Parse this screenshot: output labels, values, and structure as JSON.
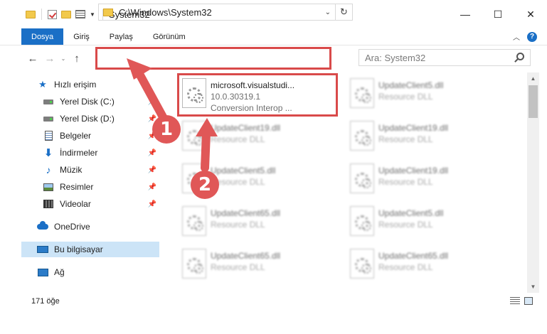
{
  "window": {
    "title": "System32",
    "minimize": "—",
    "maximize": "☐",
    "close": "✕"
  },
  "ribbon": {
    "tabs": [
      {
        "label": "Dosya",
        "active": true
      },
      {
        "label": "Giriş"
      },
      {
        "label": "Paylaş"
      },
      {
        "label": "Görünüm"
      }
    ],
    "help": "?"
  },
  "nav": {
    "back": "←",
    "forward": "→",
    "recent": "⌄",
    "up": "↑",
    "address": "C:\\Windows\\System32",
    "dropdown": "⌄",
    "refresh": "↻",
    "search_placeholder": "Ara: System32"
  },
  "sidebar": {
    "items": [
      {
        "label": "Hızlı erişim",
        "icon": "star-icon"
      },
      {
        "label": "Yerel Disk (C:)",
        "icon": "disk-icon",
        "pinned": true
      },
      {
        "label": "Yerel Disk (D:)",
        "icon": "disk-icon",
        "pinned": true
      },
      {
        "label": "Belgeler",
        "icon": "document-icon",
        "pinned": true
      },
      {
        "label": "İndirmeler",
        "icon": "download-icon",
        "pinned": true
      },
      {
        "label": "Müzik",
        "icon": "music-icon",
        "pinned": true
      },
      {
        "label": "Resimler",
        "icon": "picture-icon",
        "pinned": true
      },
      {
        "label": "Videolar",
        "icon": "video-icon",
        "pinned": true
      },
      {
        "label": "OneDrive",
        "icon": "cloud-icon"
      },
      {
        "label": "Bu bilgisayar",
        "icon": "computer-icon",
        "selected": true
      },
      {
        "label": "Ağ",
        "icon": "network-icon"
      }
    ],
    "pin_glyph": "📌"
  },
  "files": [
    {
      "name": "microsoft.visualstudi...",
      "line2": "10.0.30319.1",
      "line3": "Conversion Interop ...",
      "highlighted": true
    },
    {
      "name": "UpdateClient5.dll",
      "line2": "Resource DLL"
    },
    {
      "name": "UpdateClient19.dll",
      "line2": "Resource DLL"
    },
    {
      "name": "UpdateClient19.dll",
      "line2": "Resource DLL"
    },
    {
      "name": "UpdateClient5.dll",
      "line2": "Resource DLL"
    },
    {
      "name": "UpdateClient19.dll",
      "line2": "Resource DLL"
    },
    {
      "name": "UpdateClient65.dll",
      "line2": "Resource DLL"
    },
    {
      "name": "UpdateClient5.dll",
      "line2": "Resource DLL"
    },
    {
      "name": "UpdateClient65.dll",
      "line2": "Resource DLL"
    },
    {
      "name": "UpdateClient65.dll",
      "line2": "Resource DLL"
    }
  ],
  "status": {
    "count": "171 öğe"
  },
  "annotations": {
    "step1": "1",
    "step2": "2",
    "color": "#e05757",
    "highlight_color": "#d94a4a"
  },
  "colors": {
    "accent": "#1a6fc6",
    "selection": "#cce4f7"
  }
}
